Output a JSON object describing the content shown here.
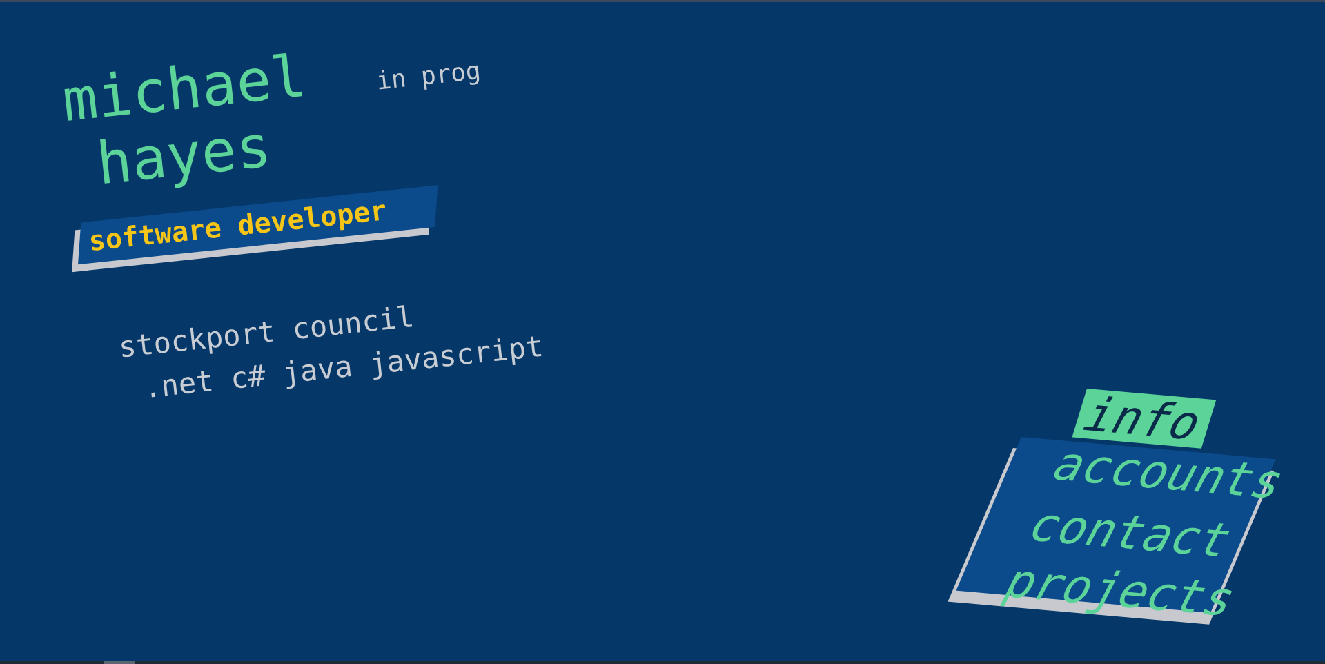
{
  "header": {
    "first_name": "michael",
    "last_name": "hayes",
    "tag": "in prog"
  },
  "role": {
    "label": "software developer"
  },
  "details": {
    "employer": "stockport council",
    "skills": ".net c# java javascript"
  },
  "nav": {
    "items": [
      {
        "label": "info",
        "active": true
      },
      {
        "label": "accounts",
        "active": false
      },
      {
        "label": "contact",
        "active": false
      },
      {
        "label": "projects",
        "active": false
      }
    ]
  },
  "colors": {
    "background": "#053769",
    "accent_green": "#5cd499",
    "panel_blue": "#0b4a8b",
    "role_yellow": "#f5c518",
    "text_grey": "#c8ccd3",
    "shadow_grey": "#c7c9ce"
  }
}
